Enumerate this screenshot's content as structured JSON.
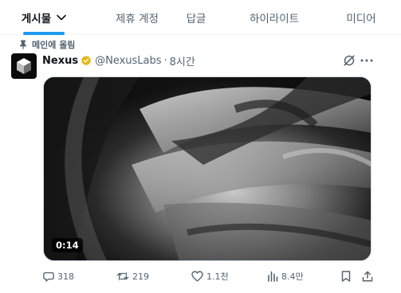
{
  "tabs": [
    {
      "label": "게시물",
      "active": true
    },
    {
      "label": "제휴 계정",
      "active": false
    },
    {
      "label": "답글",
      "active": false
    },
    {
      "label": "하이라이트",
      "active": false
    },
    {
      "label": "미디어",
      "active": false
    }
  ],
  "pinned_label": "메인에 올림",
  "post": {
    "author_name": "Nexus",
    "handle": "@NexusLabs",
    "separator": "·",
    "time": "8시간",
    "video_duration": "0:14"
  },
  "actions": {
    "replies": "318",
    "reposts": "219",
    "likes": "1.1천",
    "views": "8.4만"
  },
  "colors": {
    "accent": "#1d9bf0",
    "verified_gold": "#e2b719",
    "muted_text": "#536471",
    "primary_text": "#0f1419"
  },
  "icons": [
    "chevron-down-icon",
    "pin-icon",
    "cube-logo-icon",
    "verified-badge-icon",
    "grok-icon",
    "more-icon",
    "reply-icon",
    "repost-icon",
    "like-icon",
    "views-icon",
    "bookmark-icon",
    "share-icon"
  ]
}
